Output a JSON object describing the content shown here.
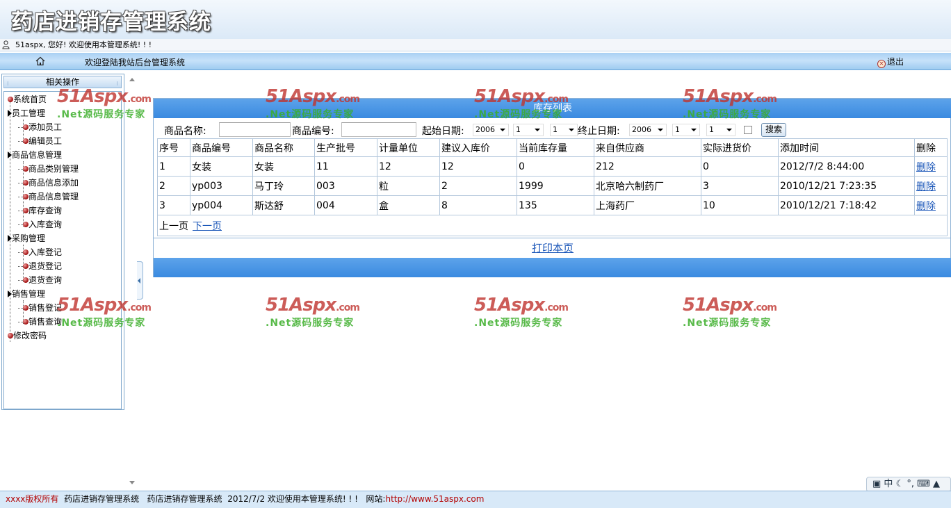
{
  "app": {
    "title": "药店进销存管理系统",
    "welcome": "51aspx, 您好! 欢迎使用本管理系统! ! !",
    "nav_welcome": "欢迎登陆我站后台管理系统",
    "logout_label": "退出"
  },
  "sidebar": {
    "header": "相关操作",
    "items": [
      {
        "label": "系统首页"
      },
      {
        "label": "员工管理"
      },
      {
        "label": "添加员工"
      },
      {
        "label": "编辑员工"
      },
      {
        "label": "商品信息管理"
      },
      {
        "label": "商品类别管理"
      },
      {
        "label": "商品信息添加"
      },
      {
        "label": "商品信息管理"
      },
      {
        "label": "库存查询"
      },
      {
        "label": "入库查询"
      },
      {
        "label": "采购管理"
      },
      {
        "label": "入库登记"
      },
      {
        "label": "退货登记"
      },
      {
        "label": "退货查询"
      },
      {
        "label": "销售管理"
      },
      {
        "label": "销售登记"
      },
      {
        "label": "销售查询"
      },
      {
        "label": "修改密码"
      }
    ]
  },
  "panel": {
    "title": "库存列表",
    "search": {
      "name_label": "商品名称:",
      "name_value": "",
      "code_label": "商品编号:",
      "code_value": "",
      "start_label": "起始日期:",
      "start_year": "2006",
      "start_month": "1",
      "start_day": "1",
      "end_label": "终止日期:",
      "end_year": "2006",
      "end_month": "1",
      "end_day": "1",
      "button": "搜索"
    },
    "table": {
      "columns": [
        "序号",
        "商品编号",
        "商品名称",
        "生产批号",
        "计量单位",
        "建议入库价",
        "当前库存量",
        "来自供应商",
        "实际进货价",
        "添加时间",
        "删除"
      ],
      "rows": [
        [
          "1",
          "女装",
          "女装",
          "11",
          "12",
          "12",
          "0",
          "212",
          "0",
          "2012/7/2 8:44:00",
          "删除"
        ],
        [
          "2",
          "yp003",
          "马丁玲",
          "003",
          "粒",
          "2",
          "1999",
          "北京哈六制药厂",
          "3",
          "2010/12/21 7:23:35",
          "删除"
        ],
        [
          "3",
          "yp004",
          "斯达舒",
          "004",
          "盒",
          "8",
          "135",
          "上海药厂",
          "10",
          "2010/12/21 7:18:42",
          "删除"
        ]
      ]
    },
    "pager": {
      "prev": "上一页",
      "next": "下一页"
    },
    "print": "打印本页"
  },
  "watermark": {
    "line1": "51Aspx",
    "suffix": ".com",
    "line2": ".Net源码服务专家"
  },
  "footer": {
    "copyright": "xxxx版权所有",
    "system1": "药店进销存管理系统",
    "system2": "药店进销存管理系统",
    "date_welcome": "2012/7/2 欢迎使用本管理系统! ! !",
    "site_label": "网站:",
    "site_url": "http://www.51aspx.com"
  },
  "ime": {
    "label": "中"
  },
  "colors": {
    "header_blue": "#3a8ae0",
    "link": "#1a56b8",
    "watermark_red": "#c0342f",
    "watermark_green": "#3cae2a"
  }
}
